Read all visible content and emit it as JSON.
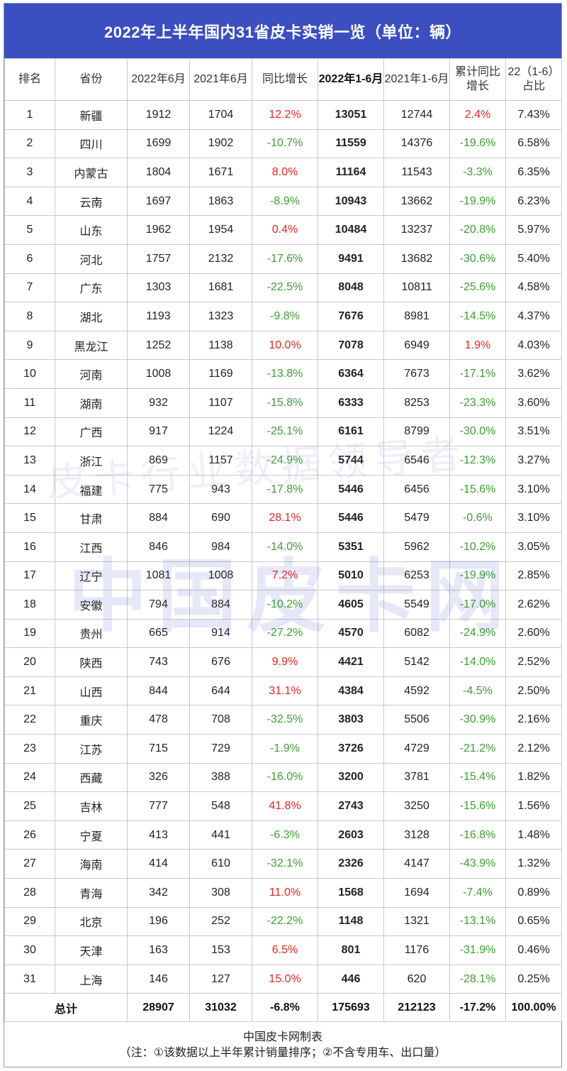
{
  "title": "2022年上半年国内31省皮卡实销一览（单位：辆）",
  "headers": {
    "rank": "排名",
    "province": "省份",
    "jun22": "2022年6月",
    "jun21": "2021年6月",
    "yoy": "同比增长",
    "h1_22": "2022年1-6月",
    "h1_21": "2021年1-6月",
    "cum_yoy": "累计同比增长",
    "share": "22（1-6）占比"
  },
  "rows": [
    {
      "rank": "1",
      "province": "新疆",
      "jun22": "1912",
      "jun21": "1704",
      "yoy": "12.2%",
      "h1_22": "13051",
      "h1_21": "12744",
      "cum_yoy": "2.4%",
      "share": "7.43%"
    },
    {
      "rank": "2",
      "province": "四川",
      "jun22": "1699",
      "jun21": "1902",
      "yoy": "-10.7%",
      "h1_22": "11559",
      "h1_21": "14376",
      "cum_yoy": "-19.6%",
      "share": "6.58%"
    },
    {
      "rank": "3",
      "province": "内蒙古",
      "jun22": "1804",
      "jun21": "1671",
      "yoy": "8.0%",
      "h1_22": "11164",
      "h1_21": "11543",
      "cum_yoy": "-3.3%",
      "share": "6.35%"
    },
    {
      "rank": "4",
      "province": "云南",
      "jun22": "1697",
      "jun21": "1863",
      "yoy": "-8.9%",
      "h1_22": "10943",
      "h1_21": "13662",
      "cum_yoy": "-19.9%",
      "share": "6.23%"
    },
    {
      "rank": "5",
      "province": "山东",
      "jun22": "1962",
      "jun21": "1954",
      "yoy": "0.4%",
      "h1_22": "10484",
      "h1_21": "13237",
      "cum_yoy": "-20.8%",
      "share": "5.97%"
    },
    {
      "rank": "6",
      "province": "河北",
      "jun22": "1757",
      "jun21": "2132",
      "yoy": "-17.6%",
      "h1_22": "9491",
      "h1_21": "13682",
      "cum_yoy": "-30.6%",
      "share": "5.40%"
    },
    {
      "rank": "7",
      "province": "广东",
      "jun22": "1303",
      "jun21": "1681",
      "yoy": "-22.5%",
      "h1_22": "8048",
      "h1_21": "10811",
      "cum_yoy": "-25.6%",
      "share": "4.58%"
    },
    {
      "rank": "8",
      "province": "湖北",
      "jun22": "1193",
      "jun21": "1323",
      "yoy": "-9.8%",
      "h1_22": "7676",
      "h1_21": "8981",
      "cum_yoy": "-14.5%",
      "share": "4.37%"
    },
    {
      "rank": "9",
      "province": "黑龙江",
      "jun22": "1252",
      "jun21": "1138",
      "yoy": "10.0%",
      "h1_22": "7078",
      "h1_21": "6949",
      "cum_yoy": "1.9%",
      "share": "4.03%"
    },
    {
      "rank": "10",
      "province": "河南",
      "jun22": "1008",
      "jun21": "1169",
      "yoy": "-13.8%",
      "h1_22": "6364",
      "h1_21": "7673",
      "cum_yoy": "-17.1%",
      "share": "3.62%"
    },
    {
      "rank": "11",
      "province": "湖南",
      "jun22": "932",
      "jun21": "1107",
      "yoy": "-15.8%",
      "h1_22": "6333",
      "h1_21": "8253",
      "cum_yoy": "-23.3%",
      "share": "3.60%"
    },
    {
      "rank": "12",
      "province": "广西",
      "jun22": "917",
      "jun21": "1224",
      "yoy": "-25.1%",
      "h1_22": "6161",
      "h1_21": "8799",
      "cum_yoy": "-30.0%",
      "share": "3.51%"
    },
    {
      "rank": "13",
      "province": "浙江",
      "jun22": "869",
      "jun21": "1157",
      "yoy": "-24.9%",
      "h1_22": "5744",
      "h1_21": "6546",
      "cum_yoy": "-12.3%",
      "share": "3.27%"
    },
    {
      "rank": "14",
      "province": "福建",
      "jun22": "775",
      "jun21": "943",
      "yoy": "-17.8%",
      "h1_22": "5446",
      "h1_21": "6456",
      "cum_yoy": "-15.6%",
      "share": "3.10%"
    },
    {
      "rank": "15",
      "province": "甘肃",
      "jun22": "884",
      "jun21": "690",
      "yoy": "28.1%",
      "h1_22": "5446",
      "h1_21": "5479",
      "cum_yoy": "-0.6%",
      "share": "3.10%"
    },
    {
      "rank": "16",
      "province": "江西",
      "jun22": "846",
      "jun21": "984",
      "yoy": "-14.0%",
      "h1_22": "5351",
      "h1_21": "5962",
      "cum_yoy": "-10.2%",
      "share": "3.05%"
    },
    {
      "rank": "17",
      "province": "辽宁",
      "jun22": "1081",
      "jun21": "1008",
      "yoy": "7.2%",
      "h1_22": "5010",
      "h1_21": "6253",
      "cum_yoy": "-19.9%",
      "share": "2.85%"
    },
    {
      "rank": "18",
      "province": "安徽",
      "jun22": "794",
      "jun21": "884",
      "yoy": "-10.2%",
      "h1_22": "4605",
      "h1_21": "5549",
      "cum_yoy": "-17.0%",
      "share": "2.62%"
    },
    {
      "rank": "19",
      "province": "贵州",
      "jun22": "665",
      "jun21": "914",
      "yoy": "-27.2%",
      "h1_22": "4570",
      "h1_21": "6082",
      "cum_yoy": "-24.9%",
      "share": "2.60%"
    },
    {
      "rank": "20",
      "province": "陕西",
      "jun22": "743",
      "jun21": "676",
      "yoy": "9.9%",
      "h1_22": "4421",
      "h1_21": "5142",
      "cum_yoy": "-14.0%",
      "share": "2.52%"
    },
    {
      "rank": "21",
      "province": "山西",
      "jun22": "844",
      "jun21": "644",
      "yoy": "31.1%",
      "h1_22": "4384",
      "h1_21": "4592",
      "cum_yoy": "-4.5%",
      "share": "2.50%"
    },
    {
      "rank": "22",
      "province": "重庆",
      "jun22": "478",
      "jun21": "708",
      "yoy": "-32.5%",
      "h1_22": "3803",
      "h1_21": "5506",
      "cum_yoy": "-30.9%",
      "share": "2.16%"
    },
    {
      "rank": "23",
      "province": "江苏",
      "jun22": "715",
      "jun21": "729",
      "yoy": "-1.9%",
      "h1_22": "3726",
      "h1_21": "4729",
      "cum_yoy": "-21.2%",
      "share": "2.12%"
    },
    {
      "rank": "24",
      "province": "西藏",
      "jun22": "326",
      "jun21": "388",
      "yoy": "-16.0%",
      "h1_22": "3200",
      "h1_21": "3781",
      "cum_yoy": "-15.4%",
      "share": "1.82%"
    },
    {
      "rank": "25",
      "province": "吉林",
      "jun22": "777",
      "jun21": "548",
      "yoy": "41.8%",
      "h1_22": "2743",
      "h1_21": "3250",
      "cum_yoy": "-15.6%",
      "share": "1.56%"
    },
    {
      "rank": "26",
      "province": "宁夏",
      "jun22": "413",
      "jun21": "441",
      "yoy": "-6.3%",
      "h1_22": "2603",
      "h1_21": "3128",
      "cum_yoy": "-16.8%",
      "share": "1.48%"
    },
    {
      "rank": "27",
      "province": "海南",
      "jun22": "414",
      "jun21": "610",
      "yoy": "-32.1%",
      "h1_22": "2326",
      "h1_21": "4147",
      "cum_yoy": "-43.9%",
      "share": "1.32%"
    },
    {
      "rank": "28",
      "province": "青海",
      "jun22": "342",
      "jun21": "308",
      "yoy": "11.0%",
      "h1_22": "1568",
      "h1_21": "1694",
      "cum_yoy": "-7.4%",
      "share": "0.89%"
    },
    {
      "rank": "29",
      "province": "北京",
      "jun22": "196",
      "jun21": "252",
      "yoy": "-22.2%",
      "h1_22": "1148",
      "h1_21": "1321",
      "cum_yoy": "-13.1%",
      "share": "0.65%"
    },
    {
      "rank": "30",
      "province": "天津",
      "jun22": "163",
      "jun21": "153",
      "yoy": "6.5%",
      "h1_22": "801",
      "h1_21": "1176",
      "cum_yoy": "-31.9%",
      "share": "0.46%"
    },
    {
      "rank": "31",
      "province": "上海",
      "jun22": "146",
      "jun21": "127",
      "yoy": "15.0%",
      "h1_22": "446",
      "h1_21": "620",
      "cum_yoy": "-28.1%",
      "share": "0.25%"
    }
  ],
  "total": {
    "label": "总计",
    "jun22": "28907",
    "jun21": "31032",
    "yoy": "-6.8%",
    "h1_22": "175693",
    "h1_21": "212123",
    "cum_yoy": "-17.2%",
    "share": "100.00%"
  },
  "watermark": {
    "line1": "皮卡行业数据领导者",
    "line2": "中国皮卡网"
  },
  "footer": {
    "line1": "中国皮卡网制表",
    "line2": "（注：①该数据以上半年累计销量排序；②不含专用车、出口量）"
  },
  "colors": {
    "title_bg": "#3b4fc0",
    "positive": "#e8251f",
    "negative": "#3f9c35"
  }
}
